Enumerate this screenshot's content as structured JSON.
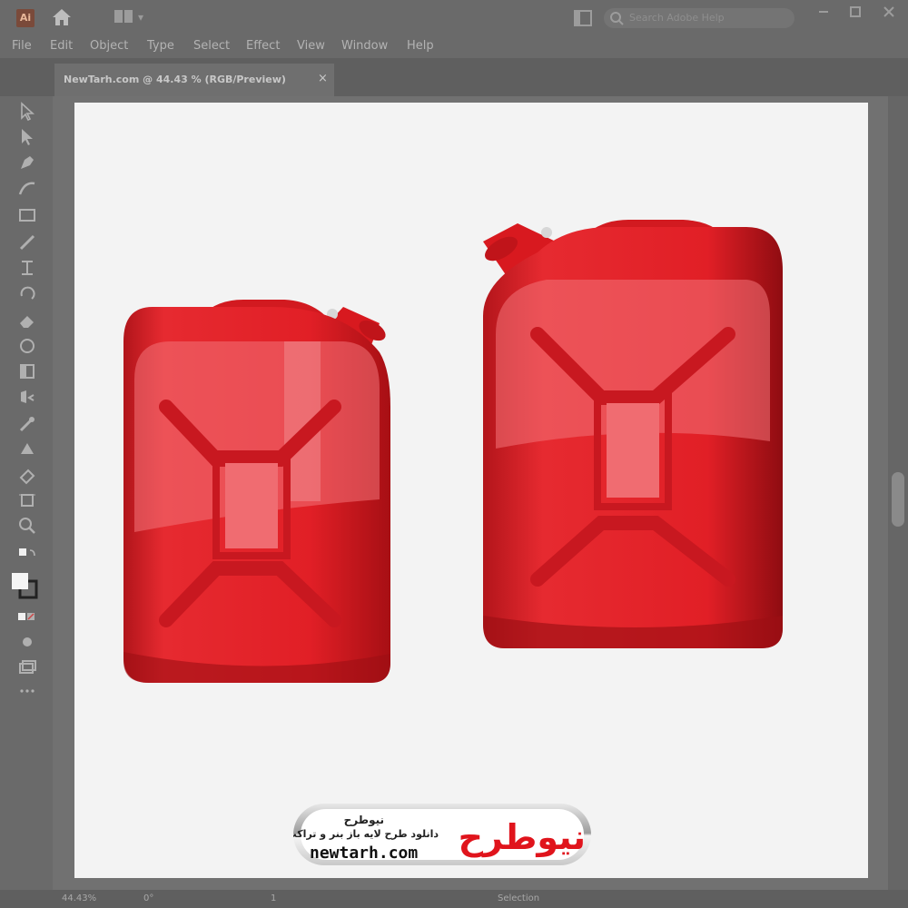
{
  "app": {
    "icon_text": "Ai",
    "search_placeholder": "Search Adobe Help"
  },
  "menu": [
    "File",
    "Edit",
    "Object",
    "Type",
    "Select",
    "Effect",
    "View",
    "Window",
    "Help"
  ],
  "document_tab": {
    "title": "NewTarh.com @ 44.43 % (RGB/Preview)",
    "close_label": "×"
  },
  "tools": [
    "selection-icon",
    "direct-selection-icon",
    "pen-icon",
    "curvature-icon",
    "rectangle-icon",
    "paintbrush-icon",
    "shaper-icon",
    "rotate-icon",
    "eraser-icon",
    "warp-icon",
    "free-transform-icon",
    "shape-builder-icon",
    "eyedropper-icon",
    "symbol-sprayer-icon",
    "column-graph-icon",
    "artboard-icon",
    "zoom-icon",
    "swap-colors-icon",
    "fill-stroke-icon",
    "color-mode-icon",
    "draw-mode-icon",
    "screen-mode-icon",
    "more-tools-icon"
  ],
  "status": {
    "zoom": "44.43%",
    "rotation": "0°",
    "artboard": "1",
    "selection": "Selection"
  },
  "artwork": {
    "can_color": "#e11f26",
    "can_highlight": "#f26b6f",
    "can_dark": "#9d0f14"
  },
  "watermark": {
    "logo_text": "نیوطرح",
    "title": "نیوطرح",
    "subtitle": "دانلود طرح لایه باز بنر و تراکت",
    "url": "newtarh.com"
  }
}
